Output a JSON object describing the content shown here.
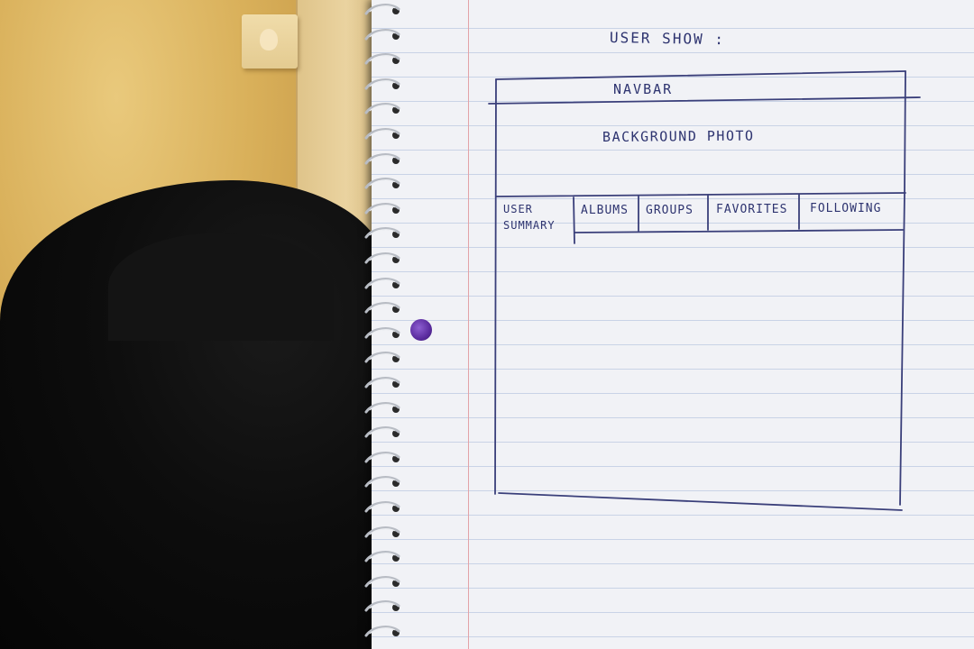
{
  "notebook": {
    "title": "USER SHOW :",
    "wireframe": {
      "navbar_label": "NAVBAR",
      "background_photo_label": "BACKGROUND PHOTO",
      "tabs": [
        {
          "label": "USER SUMMARY"
        },
        {
          "label": "ALBUMS"
        },
        {
          "label": "GROUPS"
        },
        {
          "label": "FAVORITES"
        },
        {
          "label": "FOLLOWING"
        }
      ]
    }
  },
  "colors": {
    "wall": "#d9b05a",
    "paper": "#f1f2f6",
    "ink": "#3a3f7a",
    "margin_line": "#e3a3a8",
    "punch_hole": "#5a2b9e"
  }
}
